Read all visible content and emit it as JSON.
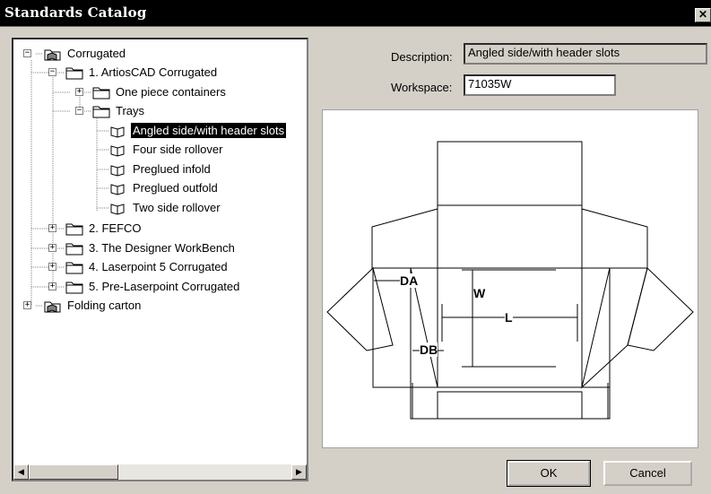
{
  "window": {
    "title": "Standards Catalog",
    "close_glyph": "✕"
  },
  "tree": {
    "nodes": [
      {
        "label": "Corrugated",
        "icon": "folder-book-icon"
      },
      {
        "label": "1. ArtiosCAD Corrugated",
        "icon": "folder-icon"
      },
      {
        "label": "One piece containers",
        "icon": "folder-icon"
      },
      {
        "label": "Trays",
        "icon": "folder-icon"
      },
      {
        "label": "Angled side/with header slots",
        "icon": "open-book-icon",
        "selected": true
      },
      {
        "label": "Four side rollover",
        "icon": "open-book-icon"
      },
      {
        "label": "Preglued infold",
        "icon": "open-book-icon"
      },
      {
        "label": "Preglued outfold",
        "icon": "open-book-icon"
      },
      {
        "label": "Two side rollover",
        "icon": "open-book-icon"
      },
      {
        "label": "2. FEFCO",
        "icon": "folder-icon"
      },
      {
        "label": "3. The Designer WorkBench",
        "icon": "folder-icon"
      },
      {
        "label": "4. Laserpoint 5 Corrugated",
        "icon": "folder-icon"
      },
      {
        "label": "5. Pre-Laserpoint Corrugated",
        "icon": "folder-icon"
      },
      {
        "label": "Folding carton",
        "icon": "folder-book-icon"
      }
    ],
    "toggles": [
      "−",
      "−",
      "+",
      "−",
      "+",
      "+",
      "+",
      "+",
      "+"
    ],
    "scroll_left": "◀",
    "scroll_right": "▶"
  },
  "form": {
    "description_label": "Description:",
    "description_value": "Angled side/with header slots",
    "workspace_label": "Workspace:",
    "workspace_value": "71035W"
  },
  "preview": {
    "dims": [
      "DA",
      "W",
      "L",
      "DB"
    ]
  },
  "buttons": {
    "ok": "OK",
    "cancel": "Cancel"
  }
}
